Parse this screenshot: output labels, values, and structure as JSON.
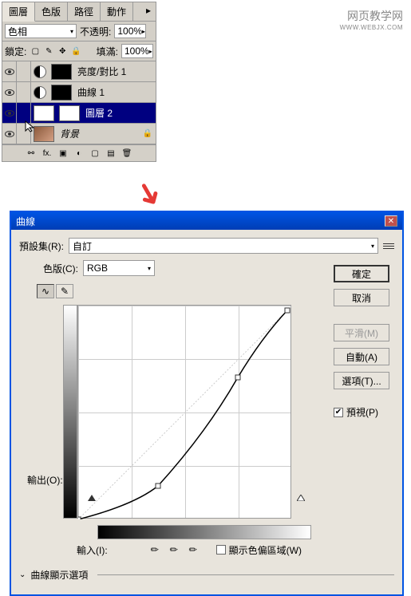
{
  "watermark": {
    "cn": "网页教学网",
    "url": "WWW.WEBJX.COM"
  },
  "layers_panel": {
    "tabs": [
      "圖層",
      "色版",
      "路徑",
      "動作"
    ],
    "blend_mode": "色相",
    "opacity_label": "不透明:",
    "opacity_value": "100%",
    "lock_label": "鎖定:",
    "fill_label": "填滿:",
    "fill_value": "100%",
    "layers": [
      {
        "name": "亮度/對比 1"
      },
      {
        "name": "曲線 1"
      },
      {
        "name": "圖層 2"
      },
      {
        "name": "背景"
      }
    ]
  },
  "curves_dialog": {
    "title": "曲線",
    "preset_label": "預設集(R):",
    "preset_value": "自訂",
    "channel_label": "色版(C):",
    "channel_value": "RGB",
    "output_label": "輸出(O):",
    "input_label": "輸入(I):",
    "show_clipping_label": "顯示色偏區域(W)",
    "display_options": "曲線顯示選項",
    "buttons": {
      "ok": "確定",
      "cancel": "取消",
      "smooth": "平滑(M)",
      "auto": "自動(A)",
      "options": "選項(T)..."
    },
    "preview_label": "預視(P)"
  },
  "chart_data": {
    "type": "line",
    "title": "",
    "xlabel": "輸入(I)",
    "ylabel": "輸出(O)",
    "xlim": [
      0,
      255
    ],
    "ylim": [
      0,
      255
    ],
    "series": [
      {
        "name": "baseline",
        "x": [
          0,
          255
        ],
        "y": [
          0,
          255
        ]
      },
      {
        "name": "curve",
        "x": [
          0,
          96,
          192,
          255
        ],
        "y": [
          0,
          40,
          170,
          250
        ]
      }
    ]
  }
}
